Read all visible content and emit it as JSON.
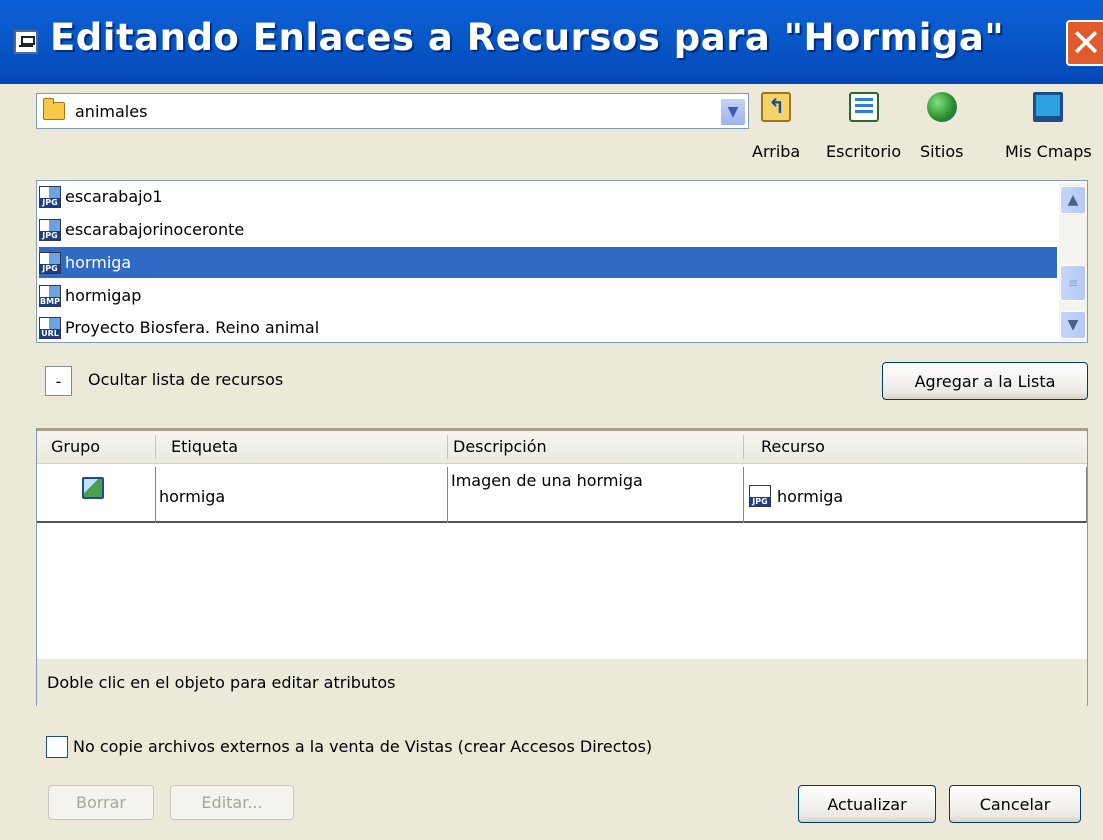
{
  "window": {
    "title": "Editando Enlaces a Recursos para \"Hormiga\"",
    "close_glyph": "✕"
  },
  "folder": {
    "current": "animales"
  },
  "toolbar": [
    {
      "label": "Arriba",
      "icon": "folder-up-icon"
    },
    {
      "label": "Escritorio",
      "icon": "desktop-icon"
    },
    {
      "label": "Sitios",
      "icon": "globe-icon"
    },
    {
      "label": "Mis Cmaps",
      "icon": "computer-icon"
    }
  ],
  "files": [
    {
      "name": "escarabajo1",
      "type": "JPG"
    },
    {
      "name": "escarabajorinoceronte",
      "type": "JPG"
    },
    {
      "name": "hormiga",
      "type": "JPG",
      "selected": true
    },
    {
      "name": "hormigap",
      "type": "BMP"
    },
    {
      "name": "Proyecto Biosfera. Reino animal",
      "type": "URL"
    }
  ],
  "resources": {
    "toggle_glyph": "-",
    "hide_label": "Ocultar lista de recursos",
    "add_button": "Agregar a la Lista"
  },
  "table": {
    "columns": [
      "Grupo",
      "Etiqueta",
      "Descripción",
      "Recurso"
    ],
    "rows": [
      {
        "group_icon": "image-icon",
        "label": "hormiga",
        "description": "Imagen de una hormiga",
        "resource": "hormiga",
        "resource_type": "JPG"
      }
    ],
    "note": "Doble clic en el objeto para editar atributos"
  },
  "options": {
    "nocopy_label": "No copie archivos externos a la venta de Vistas (crear Accesos Directos)",
    "nocopy_checked": false
  },
  "buttons": {
    "delete": "Borrar",
    "edit": "Editar...",
    "update": "Actualizar",
    "cancel": "Cancelar"
  }
}
